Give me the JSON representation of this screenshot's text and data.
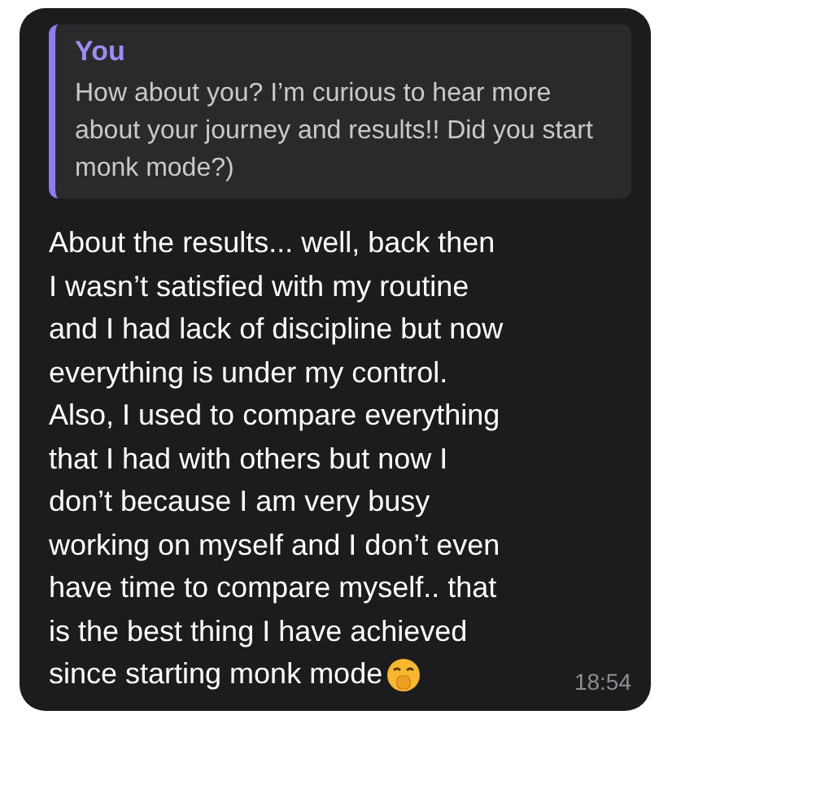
{
  "reply_quote": {
    "author": "You",
    "text": "How about you? I’m curious to hear more about your journey and results!! Did you start monk mode?)"
  },
  "message": {
    "lines": [
      "About the results... well, back then",
      "I wasn’t satisfied with my routine",
      "and I had lack of discipline but now",
      "everything is under my control.",
      "Also, I used to compare everything",
      "that I had with others but now I",
      "don’t because I am very busy",
      "working on myself and I don’t even",
      "have time to compare myself.. that",
      "is the best thing I have achieved",
      "since starting monk mode"
    ],
    "time": "18:54"
  }
}
